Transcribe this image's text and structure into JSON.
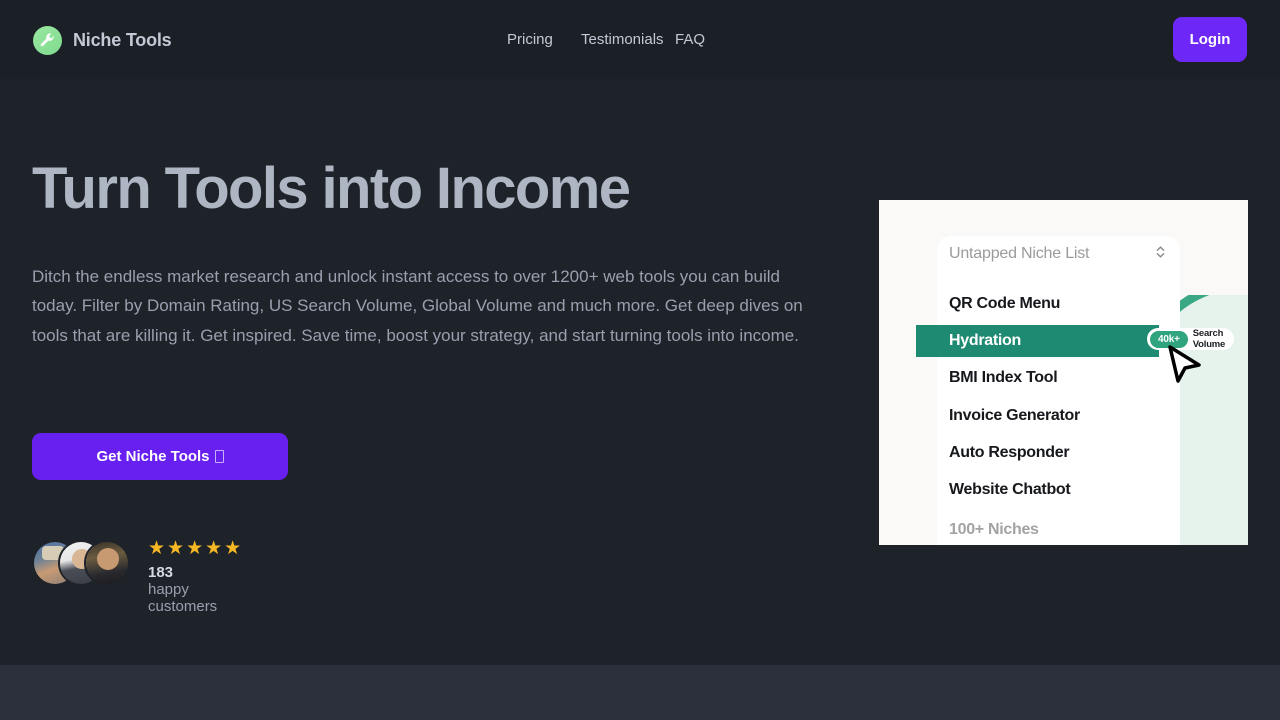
{
  "header": {
    "brand_name": "Niche Tools",
    "logo_icon": "wrench-icon",
    "nav": [
      {
        "label": "Pricing"
      },
      {
        "label": "Testimonials"
      },
      {
        "label": "FAQ"
      }
    ],
    "login_label": "Login",
    "login_color": "#6d28f7"
  },
  "hero": {
    "title": "Turn Tools into Income",
    "subtitle": "Ditch the endless market research and unlock instant access to over 1200+ web tools you can build today. Filter by Domain Rating, US Search Volume, Global Volume and much more. Get deep dives on tools that are killing it. Get inspired. Save time, boost your strategy, and start turning tools into income.",
    "cta_label": "Get Niche Tools",
    "cta_glyph": "missing-glyph-box",
    "cta_color": "#6820f0",
    "social_proof": {
      "stars": "★★★★★",
      "star_count": 5,
      "star_color": "#f5b824",
      "count": "183",
      "count_suffix": "happy customers",
      "avatar_count": 3
    }
  },
  "card": {
    "dropdown": {
      "label": "Untapped Niche List",
      "icon": "chevron-up-down-icon"
    },
    "list": [
      {
        "label": "QR Code Menu",
        "selected": false,
        "muted": false
      },
      {
        "label": "Hydration",
        "selected": true,
        "muted": false,
        "badge": {
          "value": "40k+",
          "text": "Search Volume",
          "pill_color": "#30a37f"
        }
      },
      {
        "label": "BMI Index Tool",
        "selected": false,
        "muted": false
      },
      {
        "label": "Invoice Generator",
        "selected": false,
        "muted": false
      },
      {
        "label": "Auto Responder",
        "selected": false,
        "muted": false
      },
      {
        "label": "Website Chatbot",
        "selected": false,
        "muted": false
      },
      {
        "label": "100+ Niches",
        "selected": false,
        "muted": true
      }
    ],
    "highlight_color": "#1f8a72",
    "chart_accent": "#3aa884",
    "cursor_icon": "arrow-cursor-icon"
  }
}
